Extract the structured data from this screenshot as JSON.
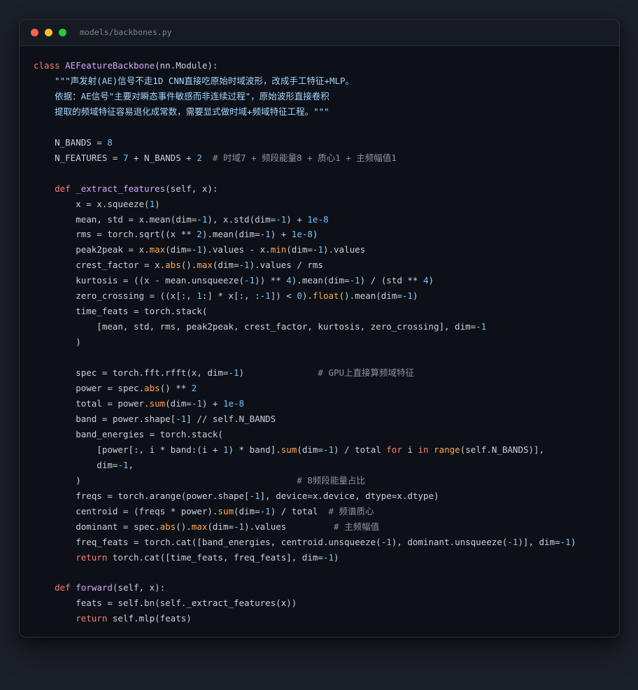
{
  "window": {
    "filename": "models/backbones.py"
  },
  "colors": {
    "keyword": "#ff7b72",
    "class_name": "#d2a8ff",
    "number": "#79c0ff",
    "string": "#a5d6ff",
    "comment": "#8b949e",
    "builtin": "#ffa657",
    "text": "#c9d1d9"
  },
  "code_lines": [
    [
      {
        "t": "kw",
        "v": "class "
      },
      {
        "t": "class",
        "v": "AEFeatureBackbone"
      },
      {
        "t": "text",
        "v": "(nn.Module):"
      }
    ],
    [
      {
        "t": "str",
        "v": "    \"\"\"声发射(AE)信号不走1D CNN直接吃原始时域波形，改成手工特征+MLP。"
      }
    ],
    [
      {
        "t": "str",
        "v": "    依据：AE信号\"主要对瞬态事件敏感而非连续过程\"，原始波形直接卷积"
      }
    ],
    [
      {
        "t": "str",
        "v": "    提取的频域特征容易退化成常数，需要显式做时域+频域特征工程。\"\"\""
      }
    ],
    [],
    [
      {
        "t": "text",
        "v": "    N_BANDS = "
      },
      {
        "t": "num",
        "v": "8"
      }
    ],
    [
      {
        "t": "text",
        "v": "    N_FEATURES = "
      },
      {
        "t": "num",
        "v": "7"
      },
      {
        "t": "text",
        "v": " + N_BANDS + "
      },
      {
        "t": "num",
        "v": "2"
      },
      {
        "t": "com",
        "v": "  # 时域7 + 频段能量8 + 质心1 + 主频幅值1"
      }
    ],
    [],
    [
      {
        "t": "kw",
        "v": "    def "
      },
      {
        "t": "fn",
        "v": "_extract_features"
      },
      {
        "t": "text",
        "v": "(self, x):"
      }
    ],
    [
      {
        "t": "text",
        "v": "        x = x.squeeze("
      },
      {
        "t": "num",
        "v": "1"
      },
      {
        "t": "text",
        "v": ")"
      }
    ],
    [
      {
        "t": "text",
        "v": "        mean, std = x.mean(dim="
      },
      {
        "t": "num",
        "v": "-1"
      },
      {
        "t": "text",
        "v": "), x.std(dim="
      },
      {
        "t": "num",
        "v": "-1"
      },
      {
        "t": "text",
        "v": ") + "
      },
      {
        "t": "num",
        "v": "1e-8"
      }
    ],
    [
      {
        "t": "text",
        "v": "        rms = torch.sqrt((x ** "
      },
      {
        "t": "num",
        "v": "2"
      },
      {
        "t": "text",
        "v": ").mean(dim="
      },
      {
        "t": "num",
        "v": "-1"
      },
      {
        "t": "text",
        "v": ") + "
      },
      {
        "t": "num",
        "v": "1e-8"
      },
      {
        "t": "text",
        "v": ")"
      }
    ],
    [
      {
        "t": "text",
        "v": "        peak2peak = x."
      },
      {
        "t": "builtin",
        "v": "max"
      },
      {
        "t": "text",
        "v": "(dim="
      },
      {
        "t": "num",
        "v": "-1"
      },
      {
        "t": "text",
        "v": ").values - x."
      },
      {
        "t": "builtin",
        "v": "min"
      },
      {
        "t": "text",
        "v": "(dim="
      },
      {
        "t": "num",
        "v": "-1"
      },
      {
        "t": "text",
        "v": ").values"
      }
    ],
    [
      {
        "t": "text",
        "v": "        crest_factor = x."
      },
      {
        "t": "builtin",
        "v": "abs"
      },
      {
        "t": "text",
        "v": "()."
      },
      {
        "t": "builtin",
        "v": "max"
      },
      {
        "t": "text",
        "v": "(dim="
      },
      {
        "t": "num",
        "v": "-1"
      },
      {
        "t": "text",
        "v": ").values / rms"
      }
    ],
    [
      {
        "t": "text",
        "v": "        kurtosis = ((x - mean.unsqueeze("
      },
      {
        "t": "num",
        "v": "-1"
      },
      {
        "t": "text",
        "v": ")) ** "
      },
      {
        "t": "num",
        "v": "4"
      },
      {
        "t": "text",
        "v": ").mean(dim="
      },
      {
        "t": "num",
        "v": "-1"
      },
      {
        "t": "text",
        "v": ") / (std ** "
      },
      {
        "t": "num",
        "v": "4"
      },
      {
        "t": "text",
        "v": ")"
      }
    ],
    [
      {
        "t": "text",
        "v": "        zero_crossing = ((x[:, "
      },
      {
        "t": "num",
        "v": "1"
      },
      {
        "t": "text",
        "v": ":] * x[:, :"
      },
      {
        "t": "num",
        "v": "-1"
      },
      {
        "t": "text",
        "v": "]) < "
      },
      {
        "t": "num",
        "v": "0"
      },
      {
        "t": "text",
        "v": ")."
      },
      {
        "t": "builtin",
        "v": "float"
      },
      {
        "t": "text",
        "v": "().mean(dim="
      },
      {
        "t": "num",
        "v": "-1"
      },
      {
        "t": "text",
        "v": ")"
      }
    ],
    [
      {
        "t": "text",
        "v": "        time_feats = torch.stack("
      }
    ],
    [
      {
        "t": "text",
        "v": "            [mean, std, rms, peak2peak, crest_factor, kurtosis, zero_crossing], dim="
      },
      {
        "t": "num",
        "v": "-1"
      }
    ],
    [
      {
        "t": "text",
        "v": "        )"
      }
    ],
    [],
    [
      {
        "t": "text",
        "v": "        spec = torch.fft.rfft(x, dim="
      },
      {
        "t": "num",
        "v": "-1"
      },
      {
        "t": "text",
        "v": ")"
      },
      {
        "t": "com",
        "v": "              # GPU上直接算频域特征"
      }
    ],
    [
      {
        "t": "text",
        "v": "        power = spec."
      },
      {
        "t": "builtin",
        "v": "abs"
      },
      {
        "t": "text",
        "v": "() ** "
      },
      {
        "t": "num",
        "v": "2"
      }
    ],
    [
      {
        "t": "text",
        "v": "        total = power."
      },
      {
        "t": "builtin",
        "v": "sum"
      },
      {
        "t": "text",
        "v": "(dim="
      },
      {
        "t": "num",
        "v": "-1"
      },
      {
        "t": "text",
        "v": ") + "
      },
      {
        "t": "num",
        "v": "1e-8"
      }
    ],
    [
      {
        "t": "text",
        "v": "        band = power.shape["
      },
      {
        "t": "num",
        "v": "-1"
      },
      {
        "t": "text",
        "v": "] // self.N_BANDS"
      }
    ],
    [
      {
        "t": "text",
        "v": "        band_energies = torch.stack("
      }
    ],
    [
      {
        "t": "text",
        "v": "            [power[:, i * band:(i + "
      },
      {
        "t": "num",
        "v": "1"
      },
      {
        "t": "text",
        "v": ") * band]."
      },
      {
        "t": "builtin",
        "v": "sum"
      },
      {
        "t": "text",
        "v": "(dim="
      },
      {
        "t": "num",
        "v": "-1"
      },
      {
        "t": "text",
        "v": ") / total "
      },
      {
        "t": "kw",
        "v": "for"
      },
      {
        "t": "text",
        "v": " i "
      },
      {
        "t": "kw",
        "v": "in"
      },
      {
        "t": "text",
        "v": " "
      },
      {
        "t": "builtin",
        "v": "range"
      },
      {
        "t": "text",
        "v": "(self.N_BANDS)],"
      }
    ],
    [
      {
        "t": "text",
        "v": "            dim="
      },
      {
        "t": "num",
        "v": "-1"
      },
      {
        "t": "text",
        "v": ","
      }
    ],
    [
      {
        "t": "text",
        "v": "        )"
      },
      {
        "t": "com",
        "v": "                                         # 8频段能量占比"
      }
    ],
    [
      {
        "t": "text",
        "v": "        freqs = torch.arange(power.shape["
      },
      {
        "t": "num",
        "v": "-1"
      },
      {
        "t": "text",
        "v": "], device=x.device, dtype=x.dtype)"
      }
    ],
    [
      {
        "t": "text",
        "v": "        centroid = (freqs * power)."
      },
      {
        "t": "builtin",
        "v": "sum"
      },
      {
        "t": "text",
        "v": "(dim="
      },
      {
        "t": "num",
        "v": "-1"
      },
      {
        "t": "text",
        "v": ") / total"
      },
      {
        "t": "com",
        "v": "  # 频谱质心"
      }
    ],
    [
      {
        "t": "text",
        "v": "        dominant = spec."
      },
      {
        "t": "builtin",
        "v": "abs"
      },
      {
        "t": "text",
        "v": "()."
      },
      {
        "t": "builtin",
        "v": "max"
      },
      {
        "t": "text",
        "v": "(dim="
      },
      {
        "t": "num",
        "v": "-1"
      },
      {
        "t": "text",
        "v": ").values"
      },
      {
        "t": "com",
        "v": "         # 主频幅值"
      }
    ],
    [
      {
        "t": "text",
        "v": "        freq_feats = torch.cat([band_energies, centroid.unsqueeze("
      },
      {
        "t": "num",
        "v": "-1"
      },
      {
        "t": "text",
        "v": "), dominant.unsqueeze("
      },
      {
        "t": "num",
        "v": "-1"
      },
      {
        "t": "text",
        "v": ")], dim="
      },
      {
        "t": "num",
        "v": "-1"
      },
      {
        "t": "text",
        "v": ")"
      }
    ],
    [
      {
        "t": "kw",
        "v": "        return"
      },
      {
        "t": "text",
        "v": " torch.cat([time_feats, freq_feats], dim="
      },
      {
        "t": "num",
        "v": "-1"
      },
      {
        "t": "text",
        "v": ")"
      }
    ],
    [],
    [
      {
        "t": "kw",
        "v": "    def "
      },
      {
        "t": "fn",
        "v": "forward"
      },
      {
        "t": "text",
        "v": "(self, x):"
      }
    ],
    [
      {
        "t": "text",
        "v": "        feats = self.bn(self._extract_features(x))"
      }
    ],
    [
      {
        "t": "kw",
        "v": "        return"
      },
      {
        "t": "text",
        "v": " self.mlp(feats)"
      }
    ]
  ]
}
